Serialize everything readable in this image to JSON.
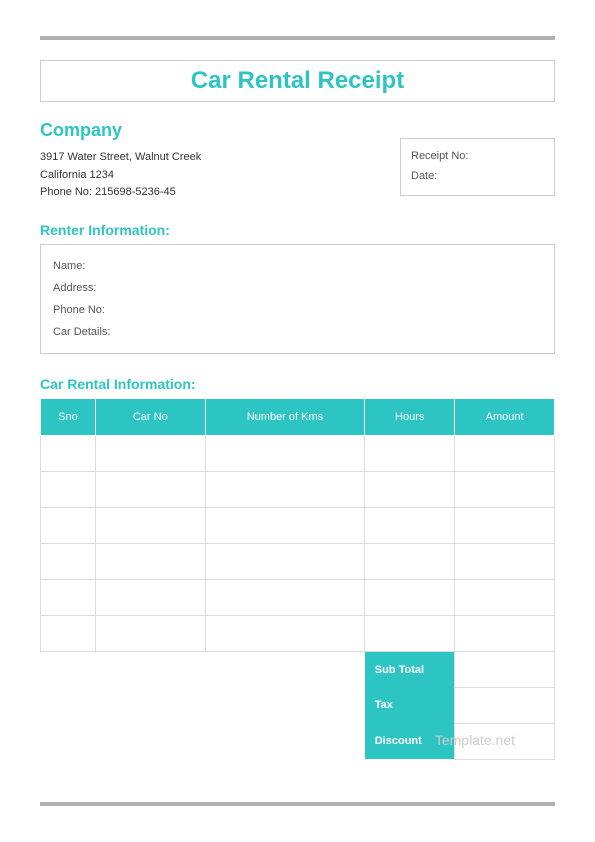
{
  "title": "Car Rental Receipt",
  "company": {
    "heading": "Company",
    "address1": "3917 Water Street, Walnut Creek",
    "address2": "California 1234",
    "phone": "Phone No: 215698-5236-45"
  },
  "receipt_box": {
    "no_label": "Receipt No:",
    "date_label": "Date:"
  },
  "renter": {
    "heading": "Renter Information:",
    "name_label": "Name:",
    "address_label": "Address:",
    "phone_label": "Phone No:",
    "car_details_label": "Car Details:"
  },
  "rental": {
    "heading": "Car Rental Information:",
    "columns": {
      "sno": "Sno",
      "carno": "Car No",
      "kms": "Number of Kms",
      "hours": "Hours",
      "amount": "Amount"
    }
  },
  "totals": {
    "subtotal": "Sub Total",
    "tax": "Tax",
    "discount": "Discount"
  },
  "watermark": "Template.net"
}
